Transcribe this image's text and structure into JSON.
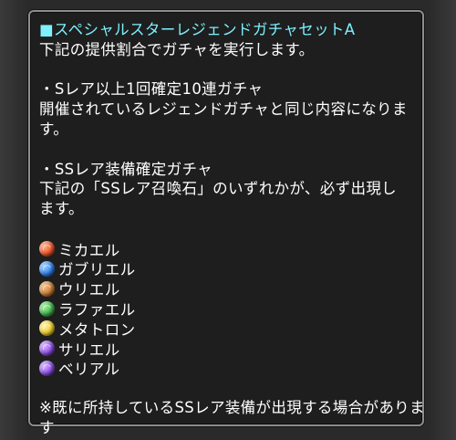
{
  "title": "■スペシャルスターレジェンドガチャセットA",
  "intro": "下記の提供割合でガチャを実行します。",
  "section1": {
    "heading": "・Sレア以上1回確定10連ガチャ",
    "body_1": "開催されているレジェンドガチャと同じ内容になりま",
    "body_2": "す。"
  },
  "section2": {
    "heading": "・SSレア装備確定ガチャ",
    "body_1": "下記の「SSレア召喚石」のいずれかが、必ず出現し",
    "body_2": "ます。"
  },
  "summons": [
    {
      "name": "ミカエル",
      "icon": "fire-element-icon",
      "color": "#e8542a"
    },
    {
      "name": "ガブリエル",
      "icon": "water-element-icon",
      "color": "#2f7ee8"
    },
    {
      "name": "ウリエル",
      "icon": "earth-element-icon",
      "color": "#c77a32"
    },
    {
      "name": "ラファエル",
      "icon": "wind-element-icon",
      "color": "#3fb04a"
    },
    {
      "name": "メタトロン",
      "icon": "light-element-icon",
      "color": "#e9c62c"
    },
    {
      "name": "サリエル",
      "icon": "dark-element-icon",
      "color": "#8a4be0"
    },
    {
      "name": "ベリアル",
      "icon": "dark-element-icon",
      "color": "#8a4be0"
    }
  ],
  "note_1": "※既に所持しているSSレア装備が出現する場合がありま",
  "note_2": "す"
}
